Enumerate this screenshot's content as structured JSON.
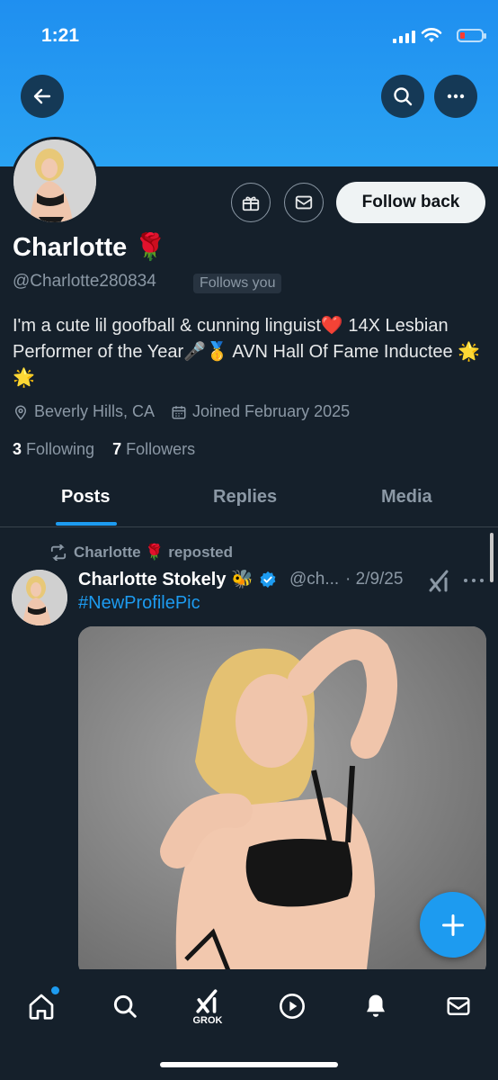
{
  "status_bar": {
    "time": "1:21"
  },
  "profile": {
    "name": "Charlotte 🌹",
    "handle": "@Charlotte280834",
    "follows_you": "Follows you",
    "follow_button": "Follow back",
    "bio": "I'm a cute lil goofball & cunning linguist❤️ 14X Lesbian Performer of the Year🎤🥇 AVN Hall Of Fame Inductee 🌟🌟",
    "location": "Beverly Hills, CA",
    "joined": "Joined February 2025",
    "following_count": "3",
    "following_label": "Following",
    "followers_count": "7",
    "followers_label": "Followers"
  },
  "tabs": [
    {
      "label": "Posts",
      "active": true
    },
    {
      "label": "Replies",
      "active": false
    },
    {
      "label": "Media",
      "active": false
    }
  ],
  "post": {
    "repost_label": "Charlotte 🌹 reposted",
    "author_name": "Charlotte Stokely 🐝",
    "author_handle": "@ch...",
    "date": "· 2/9/25",
    "text": "#NewProfilePic"
  },
  "bottom_nav": {
    "grok_label": "GROK"
  },
  "colors": {
    "accent": "#1d9bf0",
    "background": "#15202b",
    "banner": "#2aa3f3"
  },
  "icons": [
    "back-arrow-icon",
    "search-icon",
    "more-icon",
    "gift-icon",
    "mail-icon",
    "location-pin-icon",
    "calendar-icon",
    "repost-icon",
    "verified-badge-icon",
    "grok-icon",
    "plus-icon",
    "home-icon",
    "play-icon",
    "bell-icon"
  ]
}
